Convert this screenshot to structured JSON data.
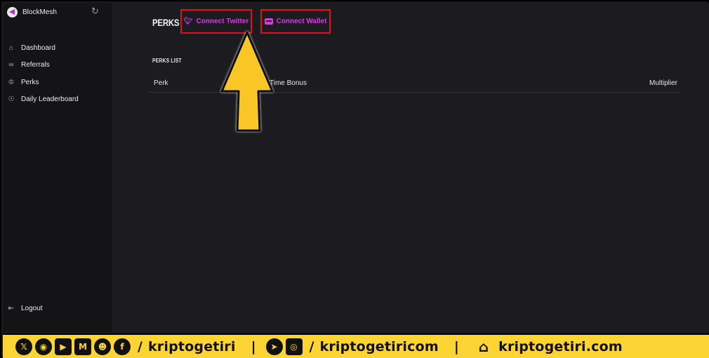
{
  "sidebar": {
    "brand": "BlockMesh",
    "items": [
      {
        "label": "Dashboard",
        "icon": "home-icon"
      },
      {
        "label": "Referrals",
        "icon": "link-icon"
      },
      {
        "label": "Perks",
        "icon": "trophy-icon"
      },
      {
        "label": "Daily Leaderboard",
        "icon": "medal-icon"
      }
    ],
    "logout": "Logout"
  },
  "main": {
    "title": "PERKS",
    "buttons": {
      "twitter": "Connect Twitter",
      "wallet": "Connect Wallet"
    },
    "section_title": "PERKS LIST",
    "table": {
      "headers": [
        "Perk",
        "Time Bonus",
        "Multiplier"
      ],
      "rows": []
    }
  },
  "footer": {
    "handle1": "kriptogetiri",
    "handle2": "kriptogetiricom",
    "site": "kriptogetiri.com",
    "separator": "|",
    "slash": "/"
  },
  "colors": {
    "accent": "#d63be0",
    "highlight_box": "#e0101c",
    "arrow": "#f9c628",
    "footer_bg": "#fcd535"
  }
}
